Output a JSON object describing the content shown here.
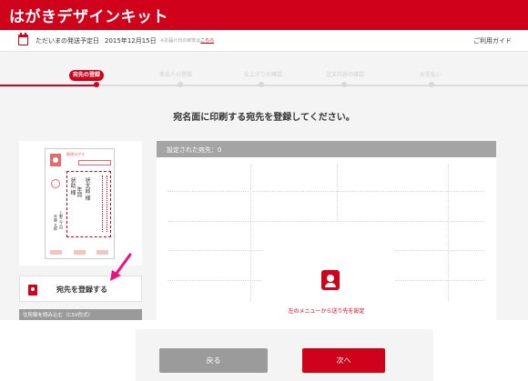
{
  "header": {
    "brand": "はがきデザインキット"
  },
  "infobar": {
    "ship_label": "ただいまの発送予定日",
    "ship_date": "2015年12月15日",
    "note_prefix": "※お届け日の目安は",
    "note_link": "こちら",
    "guide": "ご利用ガイド"
  },
  "steps": [
    {
      "label": "宛先の登録",
      "active": true
    },
    {
      "label": "差出人の登録",
      "active": false
    },
    {
      "label": "仕上がりの確認",
      "active": false
    },
    {
      "label": "注文内容の確認",
      "active": false
    },
    {
      "label": "お支払い",
      "active": false
    }
  ],
  "main": {
    "title": "宛名面に印刷する宛先を登録してください。"
  },
  "preview": {
    "card_title": "郵便はがき",
    "recipient_lines": [
      "年賀",
      "状太郎 様",
      "状助 様"
    ],
    "sender_lines": [
      "上野三丁目",
      "年賀 太郎"
    ]
  },
  "sidebar": {
    "register_label": "宛先を登録する",
    "csv_label": "住所録を読み込む（CSV形式）"
  },
  "list": {
    "header": "設定された宛先：0",
    "empty_message": "左のメニューから送り先を設定"
  },
  "footer": {
    "back_label": "戻る",
    "next_label": "次へ"
  },
  "colors": {
    "brand_red": "#d0021b",
    "arrow_pink": "#e8117f",
    "gray_button": "#9b9b9b"
  }
}
